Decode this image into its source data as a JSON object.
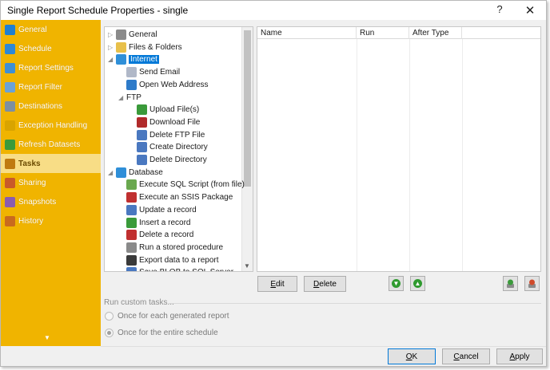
{
  "window": {
    "title": "Single Report Schedule Properties - single",
    "help": "?",
    "close": "✕"
  },
  "sidebar": {
    "items": [
      {
        "label": "General",
        "icon": "info-icon",
        "color": "#1e7fd1"
      },
      {
        "label": "Schedule",
        "icon": "clock-icon",
        "color": "#2c88d8"
      },
      {
        "label": "Report Settings",
        "icon": "report-settings-icon",
        "color": "#3d8fd6"
      },
      {
        "label": "Report Filter",
        "icon": "filter-icon",
        "color": "#6aa2d8"
      },
      {
        "label": "Destinations",
        "icon": "destinations-icon",
        "color": "#7c8fa3"
      },
      {
        "label": "Exception Handling",
        "icon": "warning-icon",
        "color": "#d9a400"
      },
      {
        "label": "Refresh Datasets",
        "icon": "refresh-icon",
        "color": "#3b9a3b"
      },
      {
        "label": "Tasks",
        "icon": "tasks-icon",
        "color": "#c07a10"
      },
      {
        "label": "Sharing",
        "icon": "sharing-icon",
        "color": "#c85a2a"
      },
      {
        "label": "Snapshots",
        "icon": "snapshots-icon",
        "color": "#8a5cb0"
      },
      {
        "label": "History",
        "icon": "history-icon",
        "color": "#c96a1e"
      }
    ],
    "active_index": 7,
    "scroll_glyph": "▼"
  },
  "tree": {
    "nodes": [
      {
        "label": "General",
        "expander": "▷",
        "icon": "gear-icon",
        "color": "#8a8a8a"
      },
      {
        "label": "Files & Folders",
        "expander": "▷",
        "icon": "folder-icon",
        "color": "#e8c04a"
      },
      {
        "label": "Internet",
        "expander": "◢",
        "icon": "globe-icon",
        "color": "#2f8fd8",
        "selected": true
      },
      {
        "label": "Send Email",
        "expander": "",
        "icon": "email-icon",
        "color": "#b0b8c8"
      },
      {
        "label": "Open Web Address",
        "expander": "",
        "icon": "web-address-icon",
        "color": "#2e7bc9"
      },
      {
        "label": "FTP",
        "expander": "◢",
        "icon": "",
        "color": ""
      },
      {
        "label": "Upload File(s)",
        "expander": "",
        "icon": "upload-icon",
        "color": "#3a9a3a"
      },
      {
        "label": "Download File",
        "expander": "",
        "icon": "download-icon",
        "color": "#b02a2a"
      },
      {
        "label": "Delete FTP File",
        "expander": "",
        "icon": "delete-ftp-file-icon",
        "color": "#4a78c0"
      },
      {
        "label": "Create Directory",
        "expander": "",
        "icon": "create-directory-icon",
        "color": "#4a78c0"
      },
      {
        "label": "Delete Directory",
        "expander": "",
        "icon": "delete-directory-icon",
        "color": "#4a78c0"
      },
      {
        "label": "Database",
        "expander": "◢",
        "icon": "database-icon",
        "color": "#2f8fd8"
      },
      {
        "label": "Execute SQL Script (from file)",
        "expander": "",
        "icon": "sql-script-icon",
        "color": "#6aa84f"
      },
      {
        "label": "Execute an SSIS Package",
        "expander": "",
        "icon": "ssis-icon",
        "color": "#c03030"
      },
      {
        "label": "Update a record",
        "expander": "",
        "icon": "update-record-icon",
        "color": "#4a78c0"
      },
      {
        "label": "Insert a record",
        "expander": "",
        "icon": "insert-record-icon",
        "color": "#3a9a3a"
      },
      {
        "label": "Delete a record",
        "expander": "",
        "icon": "delete-record-icon",
        "color": "#c03030"
      },
      {
        "label": "Run a stored procedure",
        "expander": "",
        "icon": "stored-procedure-icon",
        "color": "#8a8a8a"
      },
      {
        "label": "Export data to a report",
        "expander": "",
        "icon": "export-data-icon",
        "color": "#3a3a3a"
      },
      {
        "label": "Save BLOB to SQL Server",
        "expander": "",
        "icon": "save-blob-icon",
        "color": "#4a78c0"
      }
    ],
    "scroll_down": "▼"
  },
  "list": {
    "columns": [
      "Name",
      "Run",
      "After Type"
    ]
  },
  "buttons": {
    "edit_key": "E",
    "edit_rest": "dit",
    "delete_key": "D",
    "delete_rest": "elete",
    "move_up_glyph": "▲",
    "move_down_glyph": "▼",
    "ok_key": "O",
    "ok_rest": "K",
    "cancel_key": "C",
    "cancel_rest": "ancel",
    "apply_key": "A",
    "apply_rest": "pply"
  },
  "run_custom": {
    "label": "Run custom tasks...",
    "option_each": "Once for each generated report",
    "option_entire": "Once for the entire schedule",
    "selected": "entire"
  }
}
